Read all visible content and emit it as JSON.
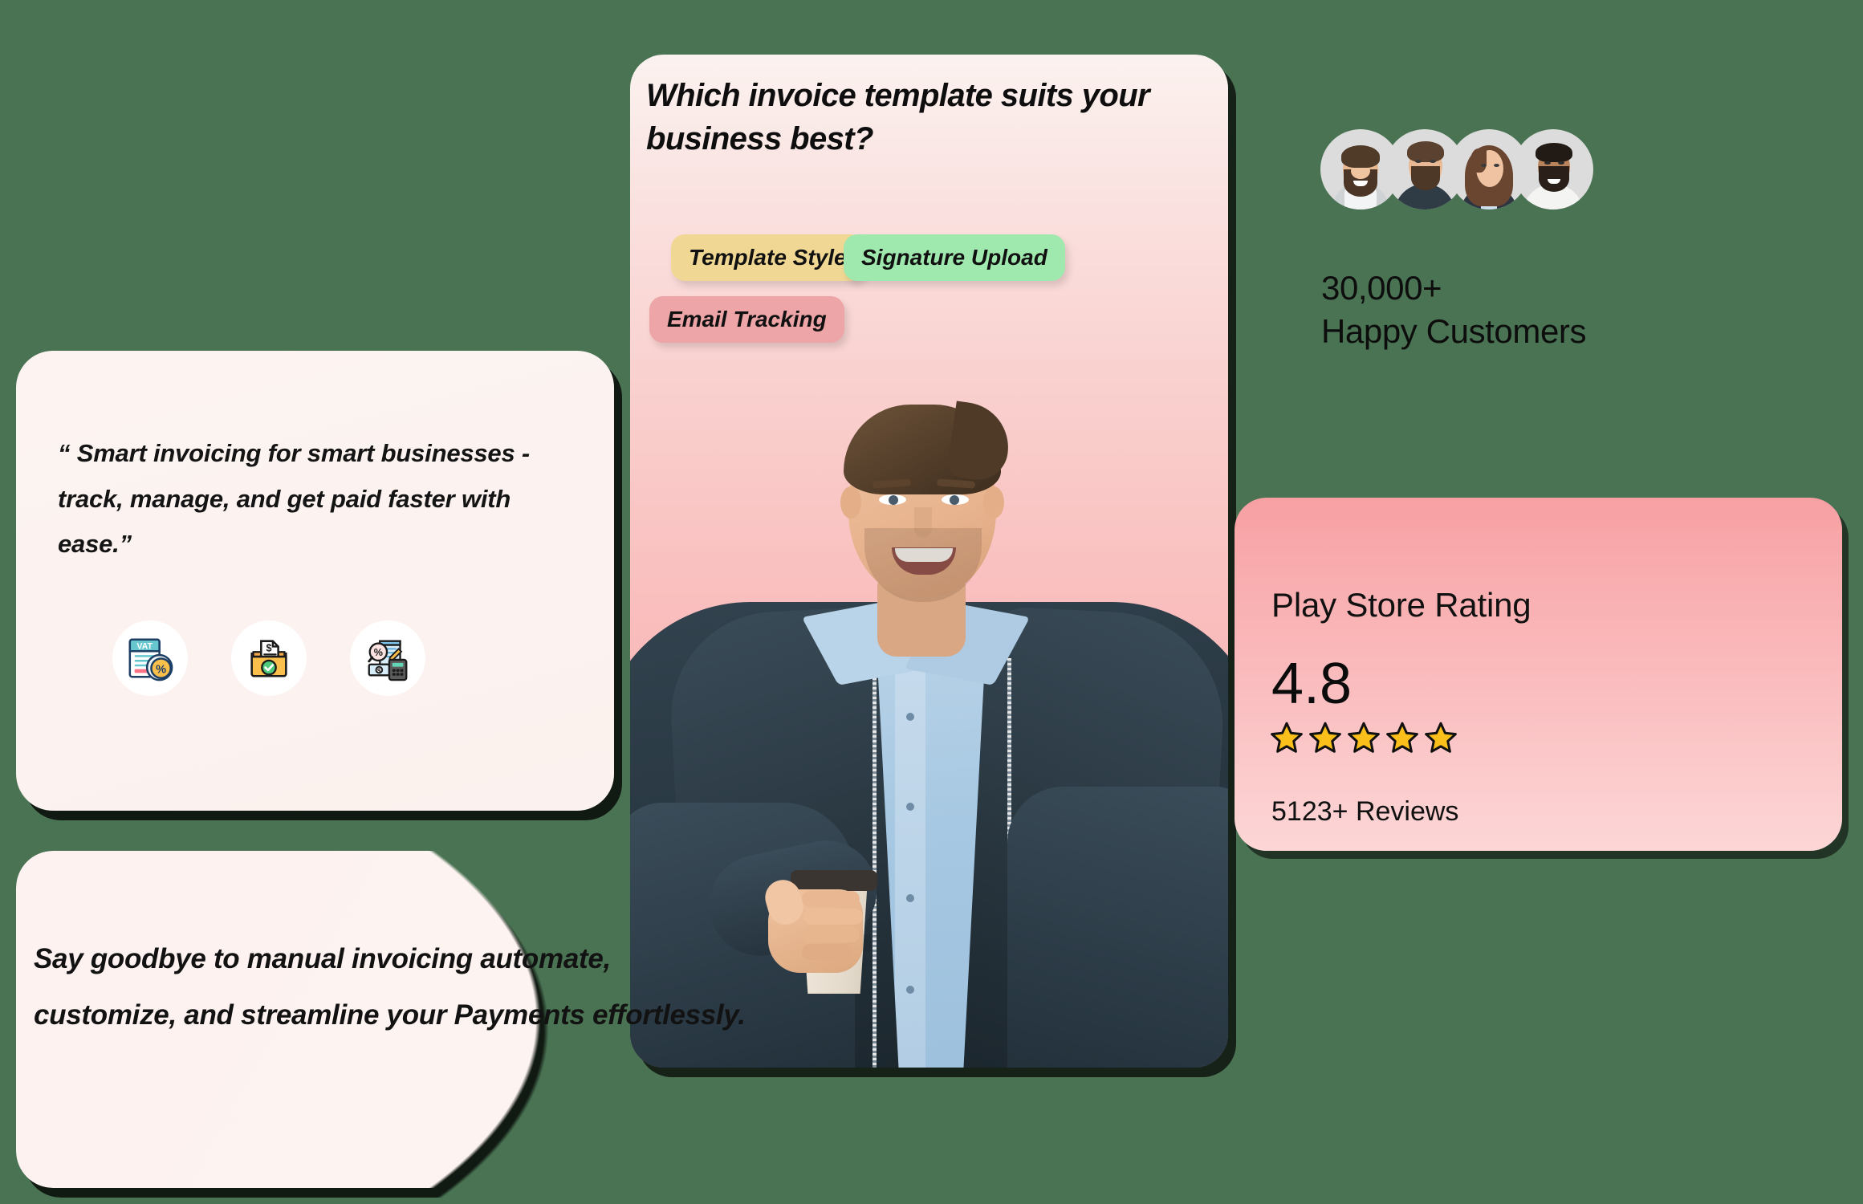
{
  "theme": {
    "background": "#4a7353",
    "chip_yellow": "#f0d894",
    "chip_green": "#9fe8ae",
    "chip_pink": "#eda5a7",
    "star_gold": "#fbbf1c",
    "card_pink_top": "#f7a0a3",
    "card_pink_bottom": "#fdd6d6"
  },
  "quote_card": {
    "quote": "“ Smart invoicing for smart businesses -track, manage, and get paid faster with ease.”",
    "icons": [
      {
        "name": "vat-document-icon",
        "label": "VAT"
      },
      {
        "name": "invoice-folder-approved-icon",
        "label": ""
      },
      {
        "name": "tax-calculator-icon",
        "label": ""
      }
    ]
  },
  "tagline_card": {
    "text": "Say goodbye to manual invoicing automate, customize, and streamline your Payments effortlessly."
  },
  "hero_card": {
    "question": "Which invoice template suits your business best?",
    "chips": [
      {
        "label": "Template Style",
        "color": "#f0d894"
      },
      {
        "label": "Signature Upload",
        "color": "#9fe8ae"
      },
      {
        "label": "Email Tracking",
        "color": "#eda5a7"
      }
    ],
    "photo_alt": "smiling man holding coffee cup"
  },
  "social_proof": {
    "avatars": [
      {
        "name": "avatar-1"
      },
      {
        "name": "avatar-2"
      },
      {
        "name": "avatar-3"
      },
      {
        "name": "avatar-4"
      }
    ],
    "count": "30,000+",
    "label": "Happy Customers"
  },
  "rating_card": {
    "title": "Play Store Rating",
    "value": "4.8",
    "stars": 5,
    "reviews": "5123+ Reviews"
  }
}
